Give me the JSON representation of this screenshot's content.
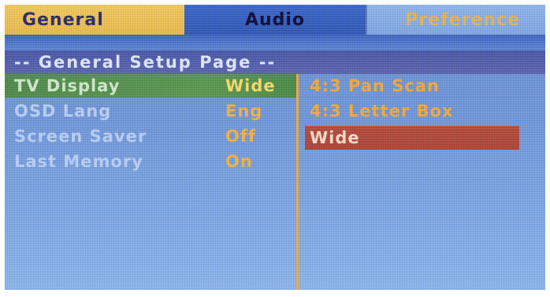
{
  "tabs": [
    {
      "label": "General"
    },
    {
      "label": "Audio"
    },
    {
      "label": "Preference"
    }
  ],
  "page_title": "-- General Setup Page --",
  "menu": {
    "items": [
      {
        "label": "TV Display",
        "value": "Wide"
      },
      {
        "label": "OSD Lang",
        "value": "Eng"
      },
      {
        "label": "Screen Saver",
        "value": "Off"
      },
      {
        "label": "Last Memory",
        "value": "On"
      }
    ]
  },
  "options": {
    "items": [
      {
        "label": "4:3 Pan Scan"
      },
      {
        "label": "4:3 Letter Box"
      },
      {
        "label": "Wide"
      }
    ]
  },
  "colors": {
    "active_tab": "#e8b84a",
    "selected_row": "#5a9650",
    "highlighted_option": "#a8453a",
    "value_text": "#f2b040"
  }
}
